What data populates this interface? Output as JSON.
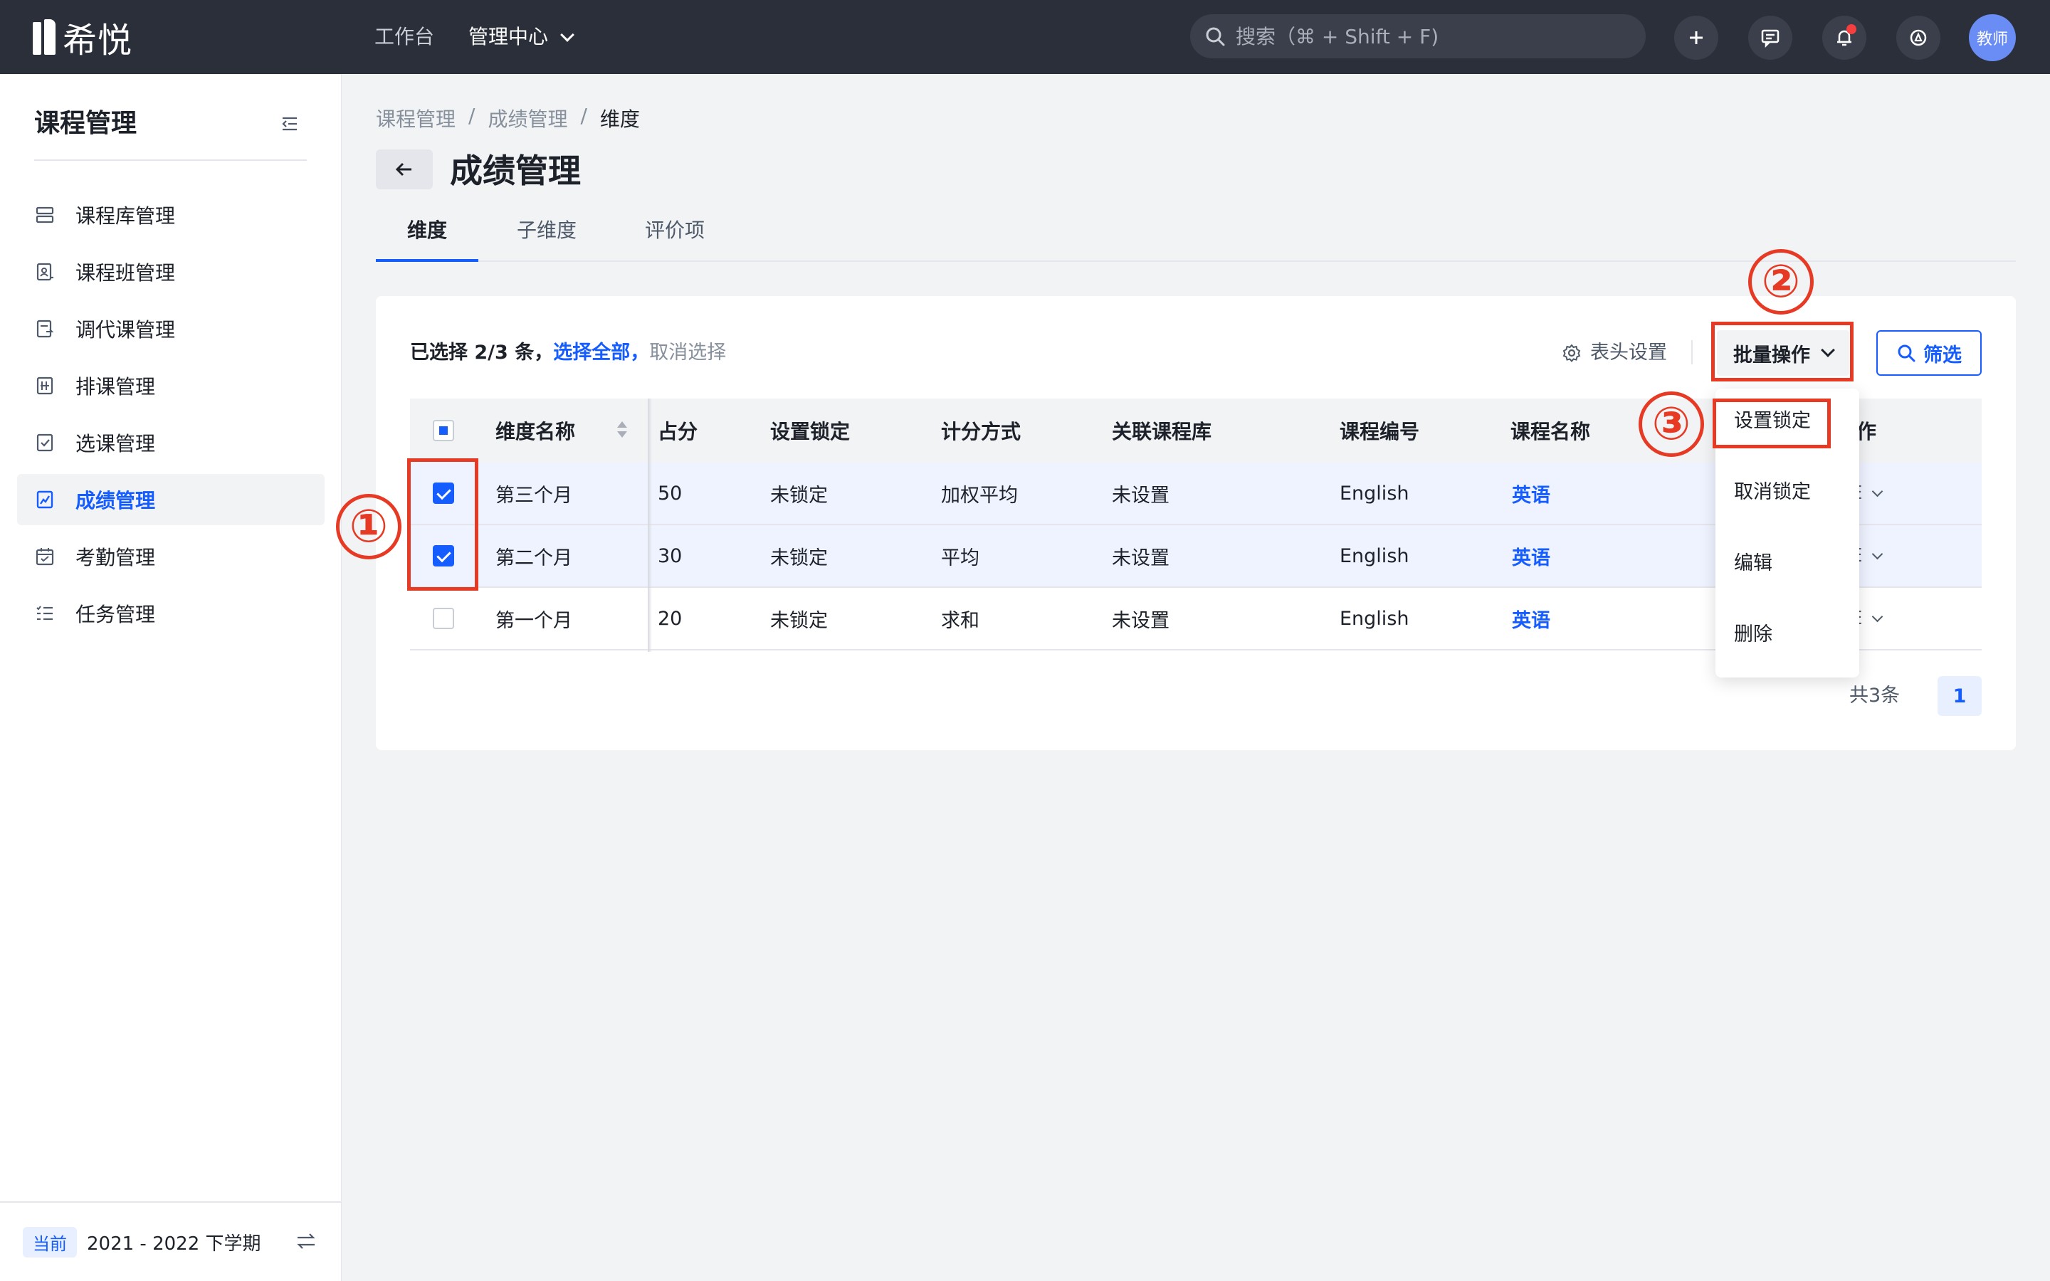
{
  "app": {
    "logo_text": "希悦",
    "nav": [
      {
        "label": "工作台"
      },
      {
        "label": "管理中心"
      }
    ],
    "search_placeholder": "搜索（⌘ + Shift + F)",
    "avatar_text": "教师",
    "colors": {
      "topbar": "#2b2f3a",
      "accent": "#165dff",
      "annotation": "#e63a24"
    }
  },
  "sidebar": {
    "title": "课程管理",
    "items": [
      {
        "label": "课程库管理",
        "icon": "database-icon"
      },
      {
        "label": "课程班管理",
        "icon": "class-icon"
      },
      {
        "label": "调代课管理",
        "icon": "swap-doc-icon"
      },
      {
        "label": "排课管理",
        "icon": "schedule-icon"
      },
      {
        "label": "选课管理",
        "icon": "checklist-icon"
      },
      {
        "label": "成绩管理",
        "icon": "grade-icon",
        "active": true
      },
      {
        "label": "考勤管理",
        "icon": "calendar-check-icon"
      },
      {
        "label": "任务管理",
        "icon": "task-list-icon"
      }
    ],
    "footer": {
      "tag": "当前",
      "term": "2021 - 2022 下学期"
    }
  },
  "main": {
    "breadcrumb": [
      "课程管理",
      "成绩管理",
      "维度"
    ],
    "title": "成绩管理",
    "tabs": [
      {
        "label": "维度",
        "active": true
      },
      {
        "label": "子维度"
      },
      {
        "label": "评价项"
      }
    ]
  },
  "toolbar": {
    "selection_count": "已选择 2/3 条，",
    "select_all": "选择全部，",
    "cancel_select": "取消选择",
    "column_settings": "表头设置",
    "batch_label": "批量操作",
    "filter_label": "筛选"
  },
  "table": {
    "headers": [
      "维度名称",
      "占分",
      "设置锁定",
      "计分方式",
      "关联课程库",
      "课程编号",
      "课程名称"
    ],
    "op_header_partial": "作",
    "rows": [
      {
        "name": "第三个月",
        "score": "50",
        "lock": "未锁定",
        "method": "加权平均",
        "lib": "未设置",
        "code": "English",
        "course": "英语",
        "checked": true
      },
      {
        "name": "第二个月",
        "score": "30",
        "lock": "未锁定",
        "method": "平均",
        "lib": "未设置",
        "code": "English",
        "course": "英语",
        "checked": true
      },
      {
        "name": "第一个月",
        "score": "20",
        "lock": "未锁定",
        "method": "求和",
        "lib": "未设置",
        "code": "English",
        "course": "英语",
        "checked": false
      }
    ],
    "op_peek": "E"
  },
  "dropdown": {
    "items": [
      "设置锁定",
      "取消锁定",
      "编辑",
      "删除"
    ]
  },
  "pagination": {
    "total": "共3条",
    "current_page": "1"
  },
  "annotations": [
    "①",
    "②",
    "③"
  ]
}
